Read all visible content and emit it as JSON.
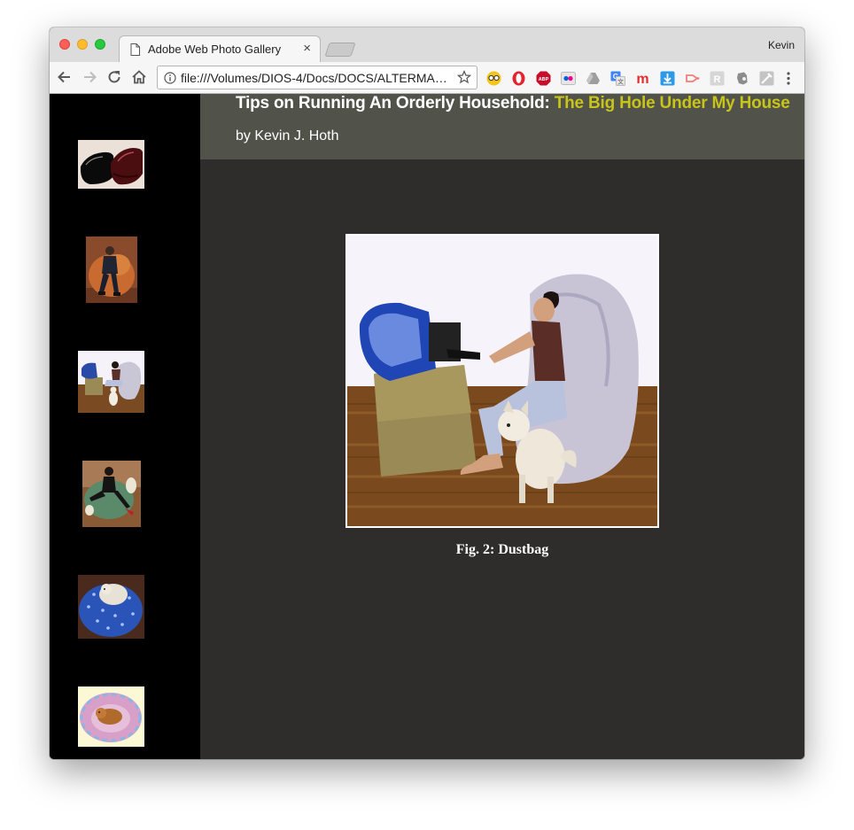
{
  "browser": {
    "tab_title": "Adobe Web Photo Gallery",
    "tab_close_glyph": "×",
    "profile_name": "Kevin",
    "url": "file:///Volumes/DIOS-4/Docs/DOCS/ALTERMA…",
    "extensions": [
      "glasses-extension",
      "opera-extension",
      "adblock-plus-extension",
      "flickr-extension",
      "drive-extension",
      "google-translate-extension",
      "m-extension",
      "download-extension",
      "arrow-extension",
      "r-extension",
      "evernote-extension",
      "tools-extension"
    ]
  },
  "page": {
    "title": "Tips on Running An Orderly Household:",
    "title_accent": "The Big Hole Under My House",
    "byline": "by Kevin J. Hoth",
    "caption": "Fig. 2: Dustbag",
    "accent_color": "#c7c41a",
    "header_bg": "#51524a",
    "content_bg": "#2e2d2b"
  },
  "thumbnails": [
    {
      "name": "thumb-shoes",
      "subject": "shoes"
    },
    {
      "name": "thumb-man-beanbag",
      "subject": "man on orange beanbag"
    },
    {
      "name": "thumb-woman-computer",
      "subject": "woman at computer on beanbag"
    },
    {
      "name": "thumb-woman-green-beanbag",
      "subject": "woman on green beanbag with dog"
    },
    {
      "name": "thumb-dog-blue-beanbag",
      "subject": "dog on blue star beanbag"
    },
    {
      "name": "thumb-dog-pink-bed",
      "subject": "dog on pink pet bed"
    }
  ]
}
